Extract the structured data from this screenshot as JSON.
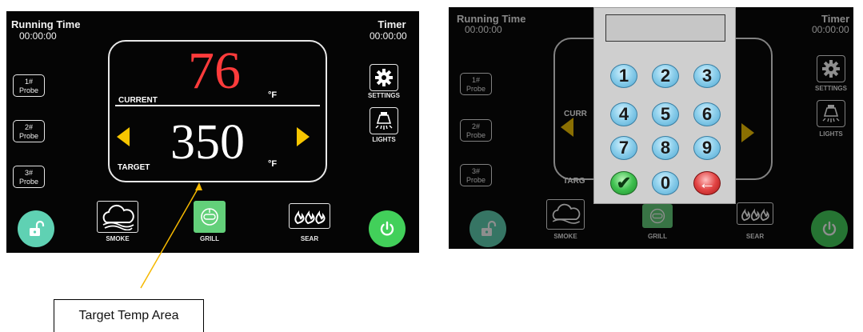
{
  "colors": {
    "screen_bg": "#050505",
    "current_temp": "#ff3b3b",
    "arrow": "#f7c600",
    "lock_button": "#5fd1b3",
    "power_button": "#42d05a",
    "grill_active": "#63d07a",
    "callout_line": "#f5b800"
  },
  "left_screen": {
    "running_time_label": "Running Time",
    "running_time_value": "00:00:00",
    "timer_label": "Timer",
    "timer_value": "00:00:00",
    "probes": [
      {
        "line1": "1#",
        "line2": "Probe"
      },
      {
        "line1": "2#",
        "line2": "Probe"
      },
      {
        "line1": "3#",
        "line2": "Probe"
      }
    ],
    "current_temp": "76",
    "current_label": "CURRENT",
    "current_unit": "°F",
    "target_temp": "350",
    "target_label": "TARGET",
    "target_unit": "°F",
    "settings_label": "SETTINGS",
    "lights_label": "LIGHTS",
    "modes": {
      "smoke": "SMOKE",
      "grill": "GRILL",
      "sear": "SEAR"
    },
    "icons": {
      "settings": "gear-icon",
      "lights": "light-bulb-icon",
      "lock": "unlock-icon",
      "power": "power-icon",
      "smoke": "cloud-icon",
      "grill": "grill-icon",
      "sear": "flame-icon"
    }
  },
  "right_screen": {
    "running_time_label": "Running Time",
    "running_time_value": "00:00:00",
    "timer_label": "Timer",
    "timer_value": "00:00:00",
    "probes": [
      {
        "line1": "1#",
        "line2": "Probe"
      },
      {
        "line1": "2#",
        "line2": "Probe"
      },
      {
        "line1": "3#",
        "line2": "Probe"
      }
    ],
    "current_label_partial": "CURR",
    "target_label_partial": "TARG",
    "settings_label": "SETTINGS",
    "lights_label": "LIGHTS",
    "modes": {
      "smoke": "SMOKE",
      "grill": "GRILL",
      "sear": "SEAR"
    },
    "keypad": {
      "display_value": "",
      "keys": [
        "1",
        "2",
        "3",
        "4",
        "5",
        "6",
        "7",
        "8",
        "9",
        "✔",
        "0",
        "←"
      ]
    }
  },
  "callout": {
    "label": "Target Temp Area"
  }
}
